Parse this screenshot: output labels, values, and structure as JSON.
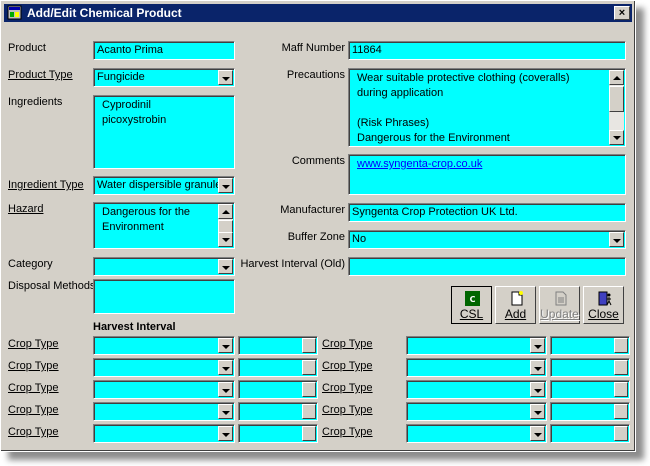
{
  "window": {
    "title": "Add/Edit Chemical Product",
    "close_glyph": "×"
  },
  "labels": {
    "product": "Product",
    "product_type": "Product Type",
    "ingredients": "Ingredients",
    "ingredient_type": "Ingredient Type",
    "hazard": "Hazard",
    "category": "Category",
    "disposal_methods": "Disposal Methods",
    "harvest_interval_heading": "Harvest Interval",
    "maff_number": "Maff Number",
    "precautions": "Precautions",
    "comments": "Comments",
    "manufacturer": "Manufacturer",
    "buffer_zone": "Buffer Zone",
    "harvest_interval_old": "Harvest Interval (Old)",
    "crop_type": "Crop Type"
  },
  "values": {
    "product": "Acanto Prima",
    "product_type": "Fungicide",
    "ingredients": [
      "Cyprodinil",
      "picoxystrobin"
    ],
    "ingredient_type": "Water dispersible granule",
    "hazard": [
      "Dangerous for the",
      "Environment"
    ],
    "category": "",
    "disposal_methods": "",
    "maff_number": "11864",
    "precautions": [
      "Wear suitable protective clothing (coveralls)",
      "during application",
      "",
      "(Risk Phrases)",
      "Dangerous for the Environment"
    ],
    "comments": "www.syngenta-crop.co.uk",
    "manufacturer": "Syngenta Crop Protection UK Ltd.",
    "buffer_zone": "No",
    "harvest_interval_old": ""
  },
  "toolbar": {
    "csl": "CSL",
    "add": "Add",
    "update": "Update",
    "close": "Close"
  },
  "colors": {
    "field_bg": "#00ffff",
    "face": "#d4d0c8",
    "title_bg": "#0a246a",
    "link": "#0000ff"
  },
  "icons": {
    "app": "app-window-icon",
    "csl": "csl-logo-icon",
    "add": "new-document-icon",
    "update": "update-document-icon",
    "close": "exit-door-icon"
  }
}
